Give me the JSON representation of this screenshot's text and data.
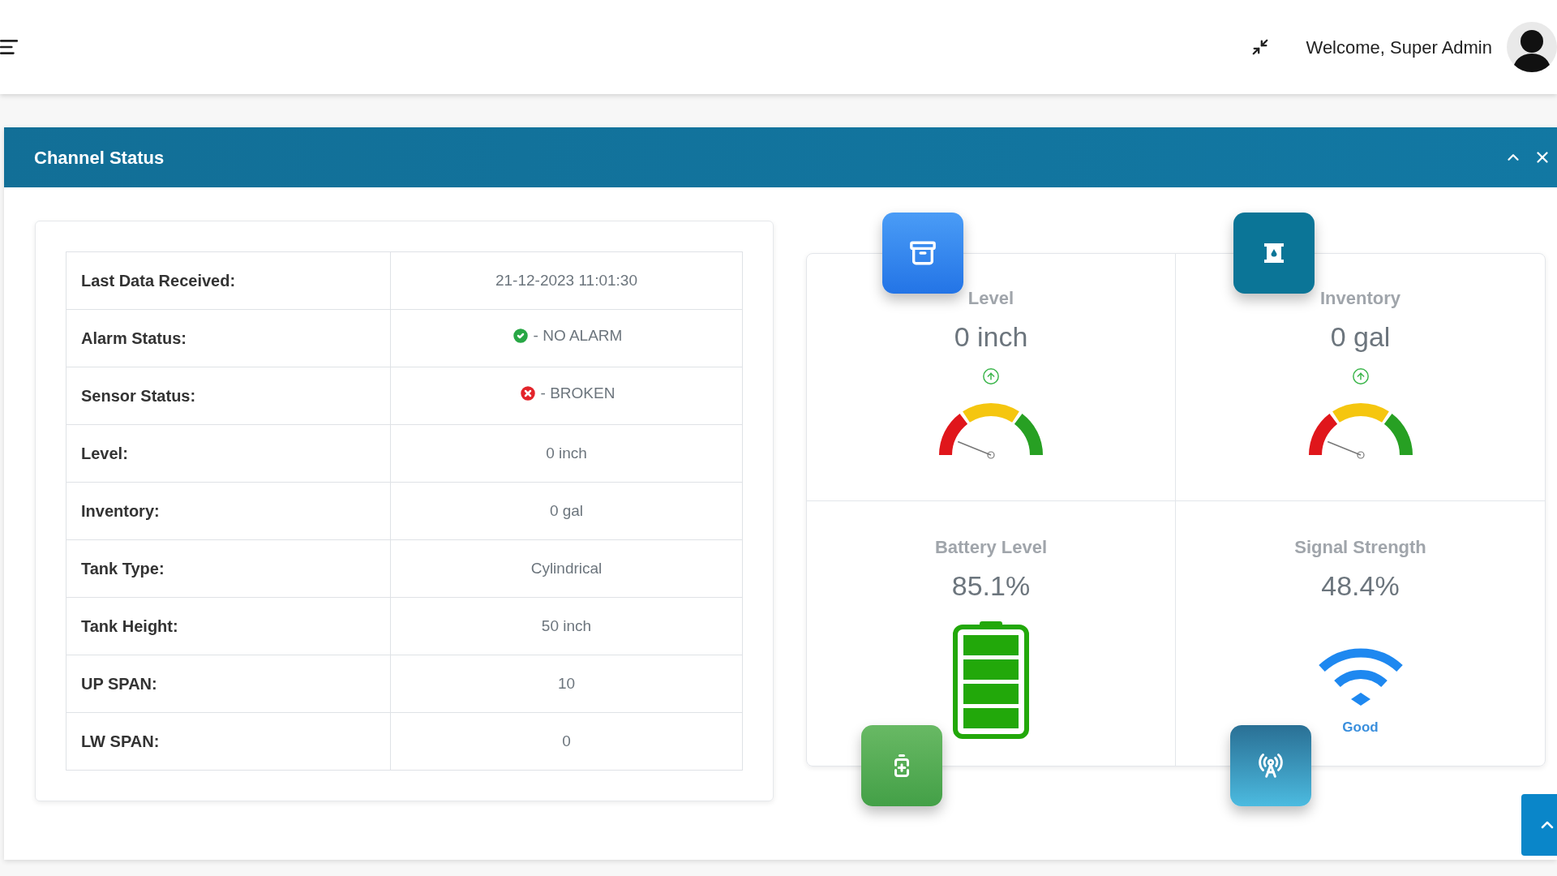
{
  "header": {
    "welcome": "Welcome, Super Admin"
  },
  "panel": {
    "title": "Channel Status"
  },
  "details": [
    {
      "kind": "plain",
      "label": "Last Data Received:",
      "value": "21-12-2023 11:01:30"
    },
    {
      "kind": "ok",
      "label": "Alarm Status:",
      "value": "- NO ALARM"
    },
    {
      "kind": "error",
      "label": "Sensor Status:",
      "value": "- BROKEN"
    },
    {
      "kind": "plain",
      "label": "Level:",
      "value": "0 inch"
    },
    {
      "kind": "plain",
      "label": "Inventory:",
      "value": "0 gal"
    },
    {
      "kind": "plain",
      "label": "Tank Type:",
      "value": "Cylindrical"
    },
    {
      "kind": "plain",
      "label": "Tank Height:",
      "value": "50 inch"
    },
    {
      "kind": "plain",
      "label": "UP SPAN:",
      "value": "10"
    },
    {
      "kind": "plain",
      "label": "LW SPAN:",
      "value": "0"
    }
  ],
  "tiles": [
    {
      "kind": "gauge",
      "title": "Level",
      "value": "0 inch"
    },
    {
      "kind": "gauge",
      "title": "Inventory",
      "value": "0 gal"
    },
    {
      "kind": "battery",
      "title": "Battery Level",
      "value": "85.1%"
    },
    {
      "kind": "signal",
      "title": "Signal Strength",
      "value": "48.4%",
      "caption": "Good"
    }
  ]
}
